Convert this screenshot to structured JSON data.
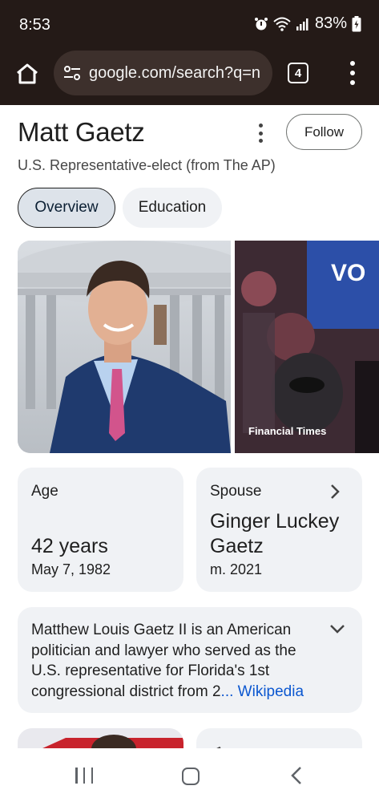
{
  "status_bar": {
    "time": "8:53",
    "battery": "83%"
  },
  "browser": {
    "url": "google.com/search?q=n",
    "tab_count": "4"
  },
  "entity": {
    "name": "Matt Gaetz",
    "description": "U.S. Representative-elect (from The AP)",
    "follow_label": "Follow"
  },
  "chips": [
    "Overview",
    "Education"
  ],
  "images": {
    "second_caption": "Financial Times"
  },
  "facts": {
    "age": {
      "label": "Age",
      "value": "42 years",
      "detail": "May 7, 1982"
    },
    "spouse": {
      "label": "Spouse",
      "value_line1": "Ginger Luckey",
      "value_line2": "Gaetz",
      "detail": "m. 2021"
    }
  },
  "summary": {
    "text": "Matthew Louis Gaetz II is an American politician and lawyer who served as the U.S. representative for Florida's 1st congressional district from 2",
    "link": "... Wikipedia"
  },
  "colors": {
    "chrome_bg": "#241a17",
    "url_bar_bg": "#3d302c",
    "link": "#0b57d0",
    "card_bg": "#f0f2f5",
    "chip_active_bg": "#dde3ea"
  },
  "icons": [
    "home-icon",
    "tune-icon",
    "tabs-icon",
    "more-vert-icon",
    "chevron-right-icon",
    "chevron-down-icon",
    "recent-apps-icon",
    "home-nav-icon",
    "back-icon"
  ]
}
